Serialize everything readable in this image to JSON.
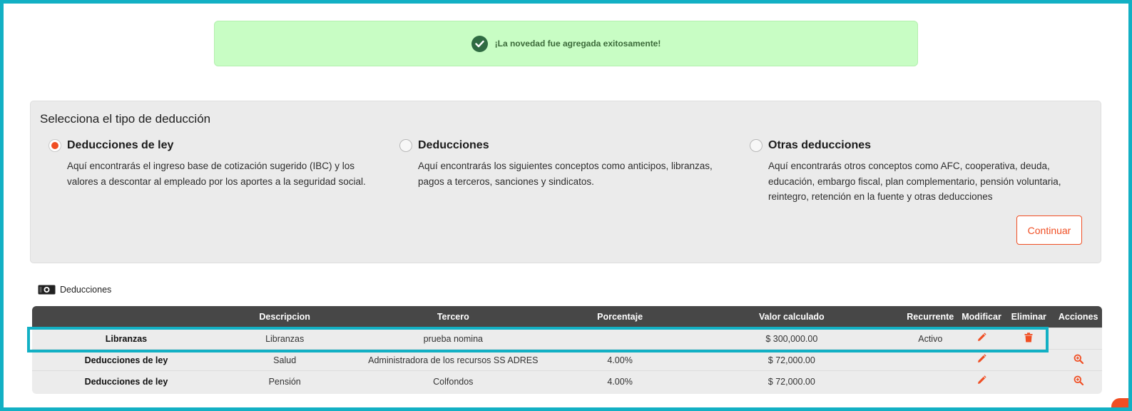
{
  "alert": {
    "message": "¡La novedad fue agregada exitosamente!",
    "icon": "check-circle-icon"
  },
  "panel": {
    "title": "Selecciona el tipo de deducción",
    "options": [
      {
        "label": "Deducciones de ley",
        "selected": true,
        "desc_lines": [
          "Aquí encontrarás el ingreso base de cotización sugerido (IBC) y los",
          "valores a descontar al empleado por los aportes a la seguridad social."
        ]
      },
      {
        "label": "Deducciones",
        "selected": false,
        "desc_lines": [
          "Aquí encontrarás los siguientes conceptos como anticipos, libranzas,",
          "pagos a terceros, sanciones y sindicatos."
        ]
      },
      {
        "label": "Otras deducciones",
        "selected": false,
        "desc_lines": [
          "Aquí encontrarás otros conceptos como AFC, cooperativa, deuda,",
          "educación, embargo fiscal, plan complementario, pensión voluntaria,",
          "reintegro, retención en la fuente y otras deducciones"
        ]
      }
    ],
    "continue_label": "Continuar"
  },
  "section": {
    "title": "Deducciones",
    "icon": "money-bill-icon"
  },
  "table": {
    "headers": [
      "",
      "Descripcion",
      "Tercero",
      "Porcentaje",
      "Valor calculado",
      "Recurrente",
      "Modificar",
      "Eliminar",
      "Acciones"
    ],
    "rows": [
      {
        "tipo": "Libranzas",
        "descripcion": "Libranzas",
        "tercero": "prueba nomina",
        "porcentaje": "",
        "valor": "$ 300,000.00",
        "recurrente": "Activo"
      },
      {
        "tipo": "Deducciones de ley",
        "descripcion": "Salud",
        "tercero": "Administradora de los recursos SS ADRES",
        "porcentaje": "4.00%",
        "valor": "$ 72,000.00",
        "recurrente": ""
      },
      {
        "tipo": "Deducciones de ley",
        "descripcion": "Pensión",
        "tercero": "Colfondos",
        "porcentaje": "4.00%",
        "valor": "$ 72,000.00",
        "recurrente": ""
      }
    ]
  },
  "colors": {
    "accent": "#f04e23",
    "highlight": "#12b0c4",
    "success_bg": "#c8fdc4",
    "header_bg": "#474747"
  }
}
